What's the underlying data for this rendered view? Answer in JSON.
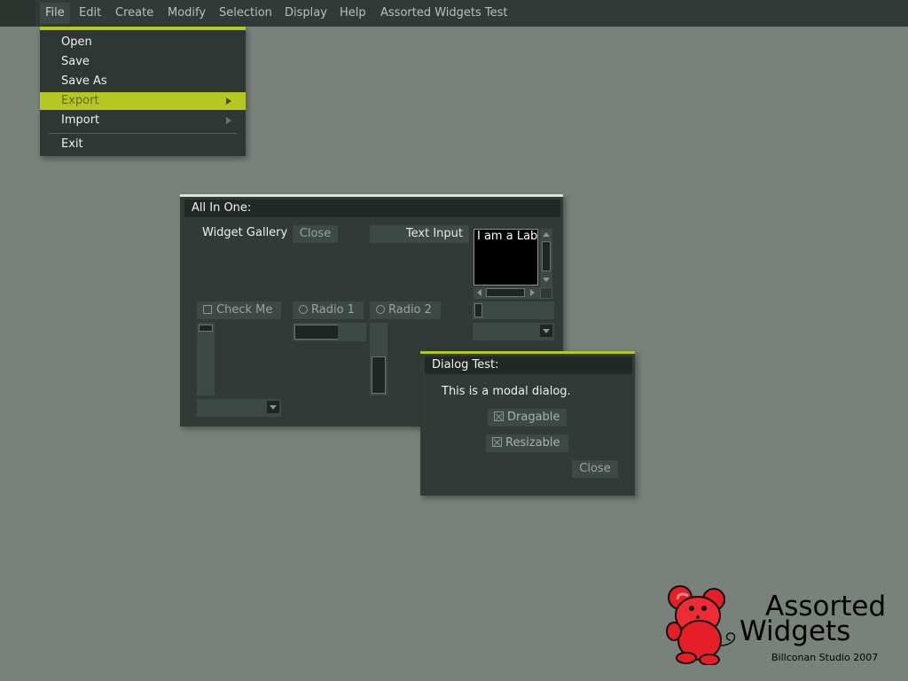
{
  "menubar": {
    "items": [
      "File",
      "Edit",
      "Create",
      "Modify",
      "Selection",
      "Display",
      "Help",
      "Assorted Widgets Test"
    ]
  },
  "file_menu": {
    "items": [
      {
        "label": "Open",
        "submenu": false,
        "highlighted": false
      },
      {
        "label": "Save",
        "submenu": false,
        "highlighted": false
      },
      {
        "label": "Save As",
        "submenu": false,
        "highlighted": false
      },
      {
        "label": "Export",
        "submenu": true,
        "highlighted": true
      },
      {
        "label": "Import",
        "submenu": true,
        "highlighted": false
      },
      {
        "label": "Exit",
        "submenu": false,
        "highlighted": false
      }
    ]
  },
  "all_in_one": {
    "title": "All In One:",
    "widget_gallery_label": "Widget Gallery",
    "close_label": "Close",
    "text_input_value": "Text Input",
    "scroll_text": "I am a Label",
    "check_me_label": "Check Me",
    "radio1_label": "Radio 1",
    "radio2_label": "Radio 2"
  },
  "dialog": {
    "title": "Dialog Test:",
    "message": "This is a modal dialog.",
    "dragable_label": "Dragable",
    "resizable_label": "Resizable",
    "close_label": "Close"
  },
  "logo": {
    "line1": "Assorted",
    "line2": "Widgets",
    "studio": "Billconan Studio 2007"
  },
  "colors": {
    "background": "#79817b",
    "panel": "#313a37",
    "accent": "#b4c820",
    "titlebar": "#212826"
  }
}
